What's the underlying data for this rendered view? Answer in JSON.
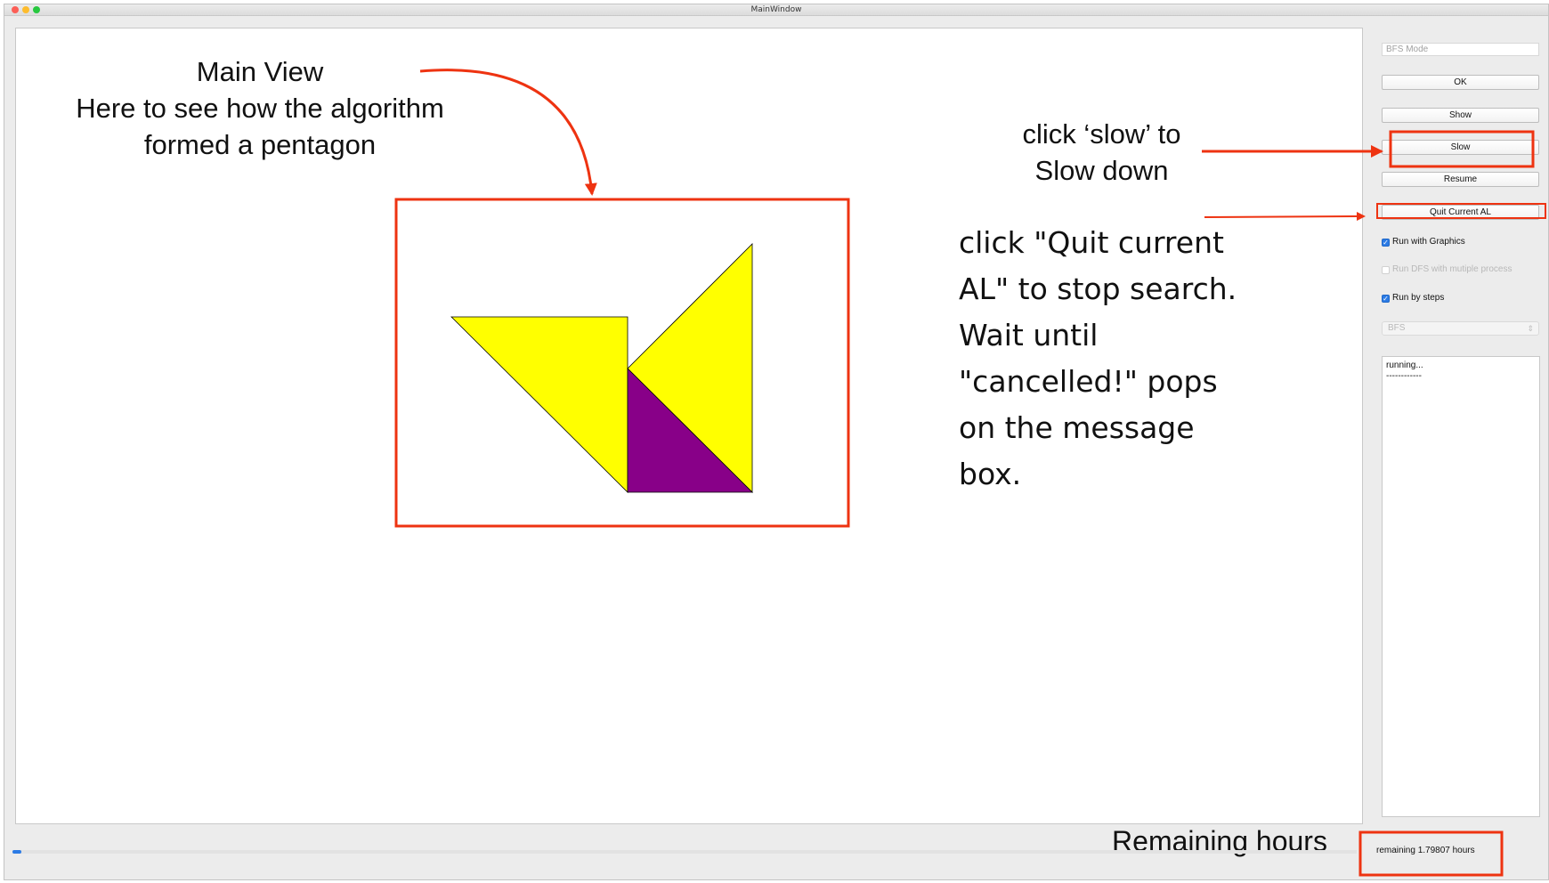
{
  "window": {
    "title": "MainWindow"
  },
  "colors": {
    "piece_fill": "#ffff00",
    "piece_accent": "#880088",
    "annotation": "#ee3311",
    "accent": "#2c7be5"
  },
  "sidebar": {
    "mode_field_value": "BFS Mode",
    "buttons": {
      "ok": "OK",
      "show": "Show",
      "slow": "Slow",
      "resume": "Resume",
      "quit": "Quit Current AL"
    },
    "checkboxes": [
      {
        "label": "Run with Graphics",
        "checked": true,
        "disabled": false
      },
      {
        "label": "Run DFS with mutiple process",
        "checked": false,
        "disabled": true
      },
      {
        "label": "Run by steps",
        "checked": true,
        "disabled": false
      }
    ],
    "algorithm_select": "BFS",
    "message_lines": [
      "running...",
      "------------"
    ]
  },
  "status": {
    "remaining": "remaining 1.79807 hours",
    "progress": 0.005
  },
  "annotations": {
    "main_view": [
      "Main View",
      "Here to see how the algorithm",
      "formed a pentagon"
    ],
    "slow": [
      "click ‘slow’ to",
      "Slow down"
    ],
    "quit": [
      "click \"Quit current",
      "AL\" to stop search.",
      "Wait until",
      "\"cancelled!\" pops",
      "on the message",
      "box."
    ],
    "remaining": "Remaining hours"
  }
}
